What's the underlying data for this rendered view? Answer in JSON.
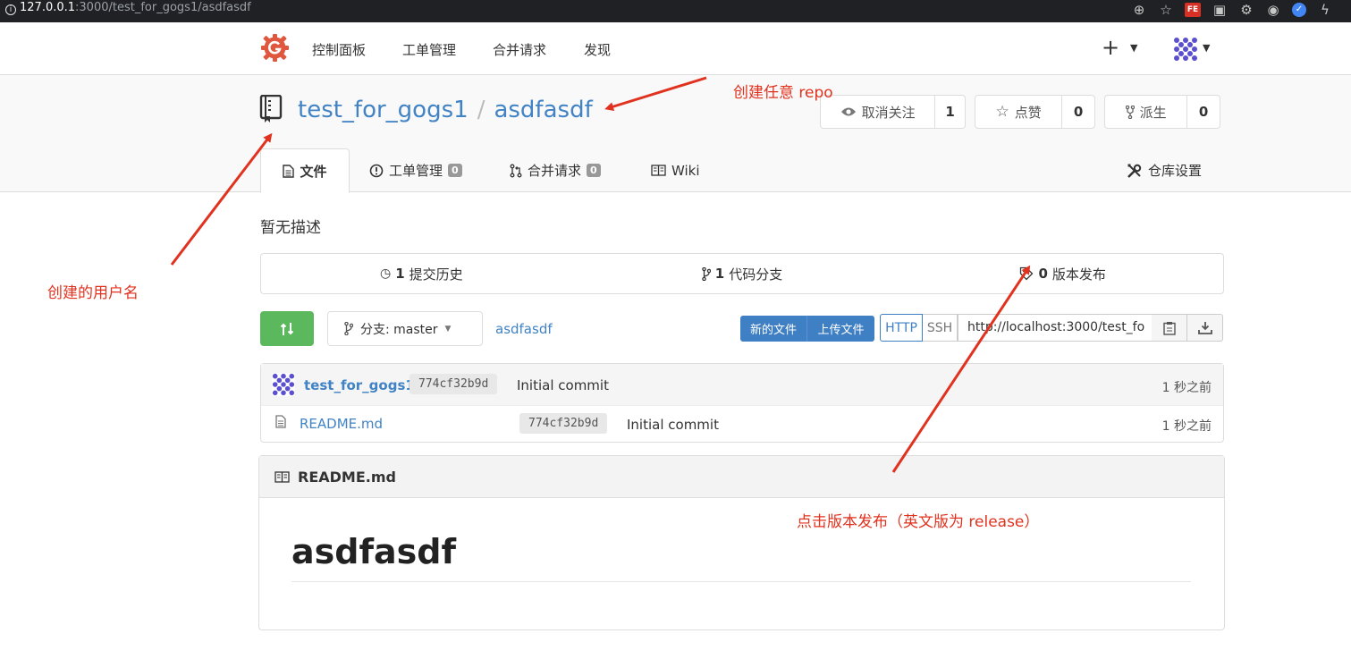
{
  "browser": {
    "url_host": "127.0.0.1",
    "url_path": ":3000/test_for_gogs1/asdfasdf",
    "ext_fe": "FE"
  },
  "nav": {
    "items": [
      "控制面板",
      "工单管理",
      "合并请求",
      "发现"
    ],
    "plus": "+"
  },
  "repo": {
    "owner": "test_for_gogs1",
    "separator": "/",
    "name": "asdfasdf",
    "watch": {
      "label": "取消关注",
      "count": "1"
    },
    "star": {
      "label": "点赞",
      "count": "0"
    },
    "fork": {
      "label": "派生",
      "count": "0"
    }
  },
  "tabs": {
    "files": "文件",
    "issues": "工单管理",
    "issues_count": "0",
    "pulls": "合并请求",
    "pulls_count": "0",
    "wiki": "Wiki",
    "settings": "仓库设置"
  },
  "description": "暂无描述",
  "stats": {
    "commits_count": "1",
    "commits_label": "提交历史",
    "branches_count": "1",
    "branches_label": "代码分支",
    "releases_count": "0",
    "releases_label": "版本发布"
  },
  "toolbar": {
    "branch_label": "分支: master",
    "breadcrumb": "asdfasdf",
    "new_file": "新的文件",
    "upload_file": "上传文件",
    "http": "HTTP",
    "ssh": "SSH",
    "clone_url": "http://localhost:3000/test_fo"
  },
  "latest_commit": {
    "author": "test_for_gogs1",
    "sha": "774cf32b9d",
    "message": "Initial commit",
    "time": "1 秒之前"
  },
  "files": [
    {
      "name": "README.md",
      "sha": "774cf32b9d",
      "message": "Initial commit",
      "time": "1 秒之前"
    }
  ],
  "readme": {
    "filename": "README.md",
    "heading": "asdfasdf"
  },
  "annotations": {
    "repo": "创建任意 repo",
    "user": "创建的用户名",
    "release": "点击版本发布（英文版为 release）"
  },
  "colors": {
    "link": "#4183c4",
    "green": "#5cb85c",
    "primary": "#3f7fc4",
    "annotation": "#e0321f"
  }
}
